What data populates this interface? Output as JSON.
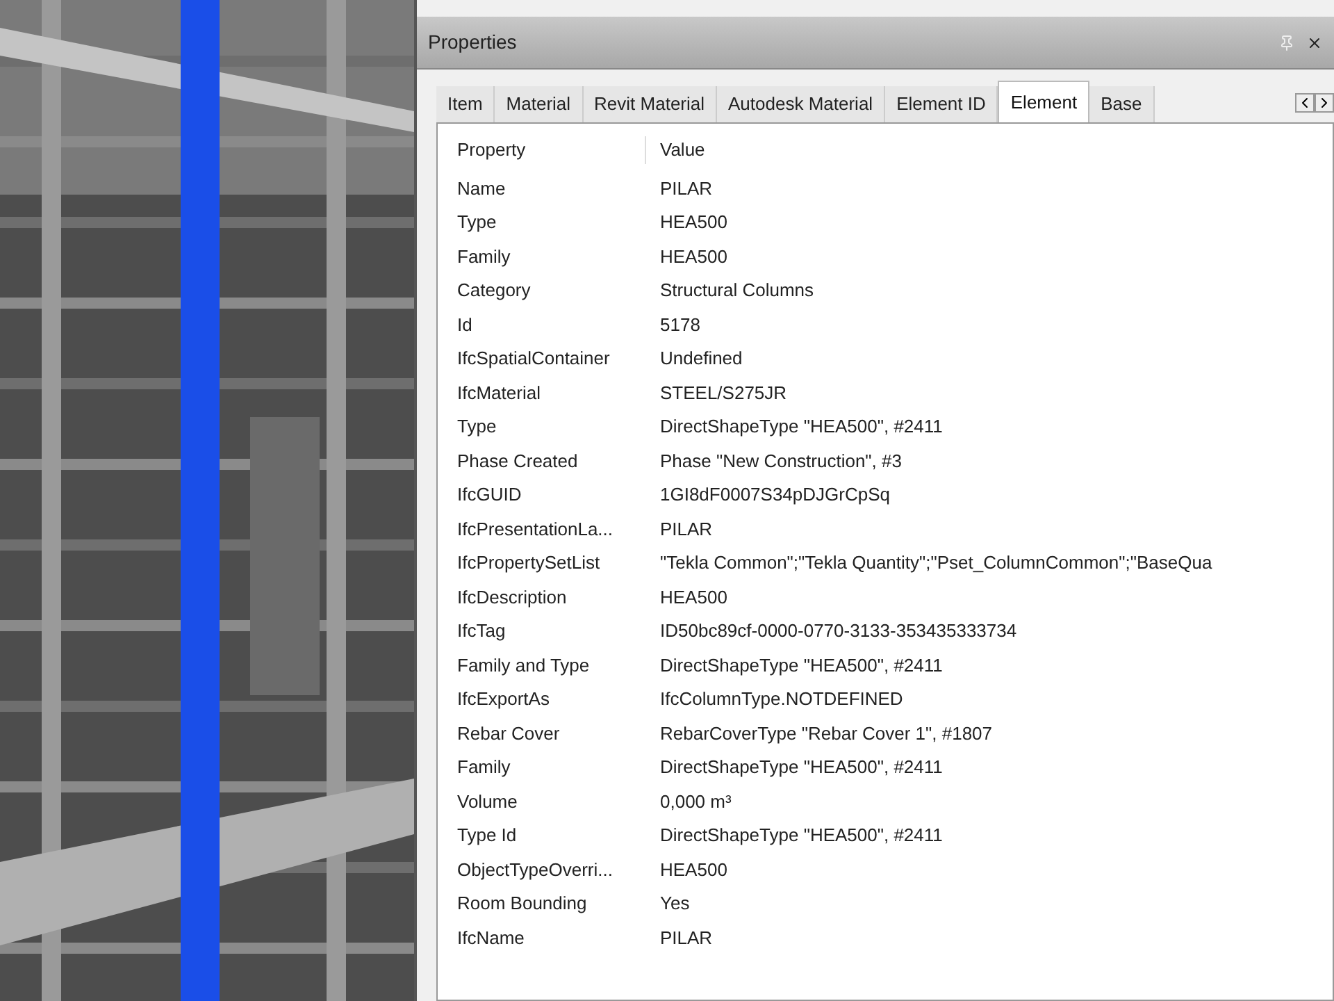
{
  "panel": {
    "title": "Properties"
  },
  "tabs": [
    {
      "label": "Item",
      "selected": false
    },
    {
      "label": "Material",
      "selected": false
    },
    {
      "label": "Revit Material",
      "selected": false
    },
    {
      "label": "Autodesk Material",
      "selected": false
    },
    {
      "label": "Element ID",
      "selected": false
    },
    {
      "label": "Element",
      "selected": true
    },
    {
      "label": "Base",
      "selected": false
    }
  ],
  "table": {
    "columns": [
      "Property",
      "Value"
    ],
    "rows": [
      [
        "Name",
        "PILAR"
      ],
      [
        "Type",
        "HEA500"
      ],
      [
        "Family",
        "HEA500"
      ],
      [
        "Category",
        "Structural Columns"
      ],
      [
        "Id",
        "5178"
      ],
      [
        "IfcSpatialContainer",
        "Undefined"
      ],
      [
        "IfcMaterial",
        "STEEL/S275JR"
      ],
      [
        "Type",
        "DirectShapeType \"HEA500\", #2411"
      ],
      [
        "Phase Created",
        "Phase \"New Construction\", #3"
      ],
      [
        "IfcGUID",
        "1GI8dF0007S34pDJGrCpSq"
      ],
      [
        "IfcPresentationLa...",
        "PILAR"
      ],
      [
        "IfcPropertySetList",
        "\"Tekla Common\";\"Tekla Quantity\";\"Pset_ColumnCommon\";\"BaseQua"
      ],
      [
        "IfcDescription",
        "HEA500"
      ],
      [
        "IfcTag",
        "ID50bc89cf-0000-0770-3133-353435333734"
      ],
      [
        "Family and Type",
        "DirectShapeType \"HEA500\", #2411"
      ],
      [
        "IfcExportAs",
        "IfcColumnType.NOTDEFINED"
      ],
      [
        "Rebar Cover",
        "RebarCoverType \"Rebar Cover 1\", #1807"
      ],
      [
        "Family",
        "DirectShapeType \"HEA500\", #2411"
      ],
      [
        "Volume",
        "0,000 m³"
      ],
      [
        "Type Id",
        "DirectShapeType \"HEA500\", #2411"
      ],
      [
        "ObjectTypeOverri...",
        "HEA500"
      ],
      [
        "Room Bounding",
        "Yes"
      ],
      [
        "IfcName",
        "PILAR"
      ]
    ]
  }
}
